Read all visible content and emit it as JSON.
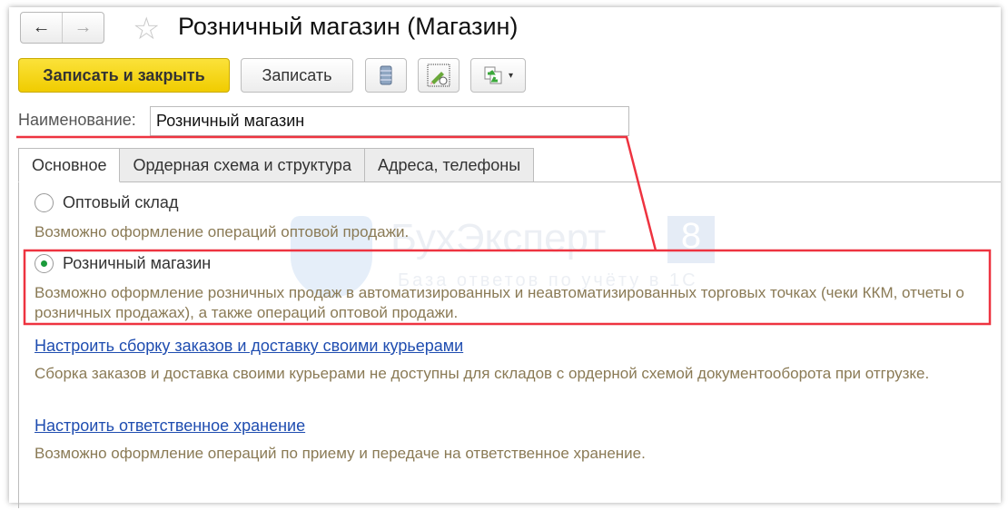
{
  "header": {
    "title": "Розничный магазин (Магазин)",
    "back": "←",
    "forward": "→"
  },
  "toolbar": {
    "save_close": "Записать и закрыть",
    "save": "Записать",
    "dropdown": "▾"
  },
  "name_field": {
    "label": "Наименование:",
    "value": "Розничный магазин"
  },
  "tabs": [
    "Основное",
    "Ордерная схема и структура",
    "Адреса, телефоны"
  ],
  "options": [
    {
      "label": "Оптовый склад",
      "selected": false,
      "description": "Возможно оформление операций оптовой продажи."
    },
    {
      "label": "Розничный магазин",
      "selected": true,
      "description": "Возможно оформление розничных продаж в автоматизированных и неавтоматизированных торговых точках (чеки ККМ, отчеты о розничных продажах), а также операций оптовой продажи."
    }
  ],
  "links": [
    {
      "label": "Настроить сборку заказов и доставку своими курьерами",
      "description": "Сборка заказов и доставка своими курьерами не доступны для складов с ордерной схемой документооборота при отгрузке."
    },
    {
      "label": "Настроить ответственное хранение",
      "description": "Возможно оформление операций по приему и передаче на ответственное хранение."
    }
  ],
  "watermark": {
    "brand": "БухЭксперт",
    "digit": "8",
    "tagline": "База ответов по учёту в 1С"
  },
  "colors": {
    "highlight": "#ee3340",
    "primary_button": "#f5d800",
    "link": "#1f4db0"
  }
}
